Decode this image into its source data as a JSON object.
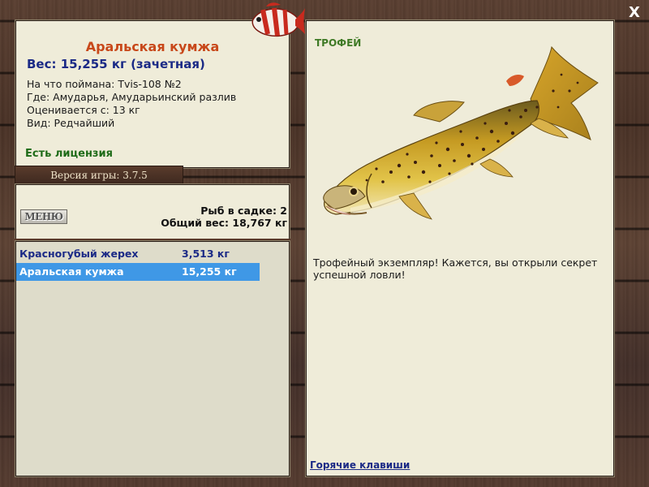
{
  "fish": {
    "name": "Аральская кумжа",
    "weight_line": "Вес: 15,255 кг (зачетная)",
    "caught_on": "На что поймана: Tvis-108 №2",
    "location": "Где: Амударья, Амударьинский разлив",
    "valued_from": "Оценивается с: 13 кг",
    "kind": "Вид: Редчайший",
    "license": "Есть лицензия"
  },
  "version": "Версия игры: 3.7.5",
  "menu_label": "МЕНЮ",
  "keepnet": {
    "count": "Рыб в садке: 2",
    "total": "Общий вес: 18,767 кг"
  },
  "catch_list": [
    {
      "name": "Красногубый жерех",
      "weight": "3,513 кг",
      "selected": false
    },
    {
      "name": "Аральская кумжа",
      "weight": "15,255 кг",
      "selected": true
    }
  ],
  "trophy": {
    "label": "ТРОФЕЙ",
    "description": "Трофейный экземпляр! Кажется, вы открыли секрет успешной ловли!"
  },
  "hotkeys_label": "Горячие клавиши",
  "close_label": "X",
  "icons": {
    "logo": "striped-fish-logo-icon",
    "close": "close-icon",
    "trophy_image": "trout-icon"
  },
  "colors": {
    "title": "#c8481a",
    "accent_blue": "#1b2a86",
    "selection": "#3f98e6",
    "license_green": "#1e6b18"
  }
}
